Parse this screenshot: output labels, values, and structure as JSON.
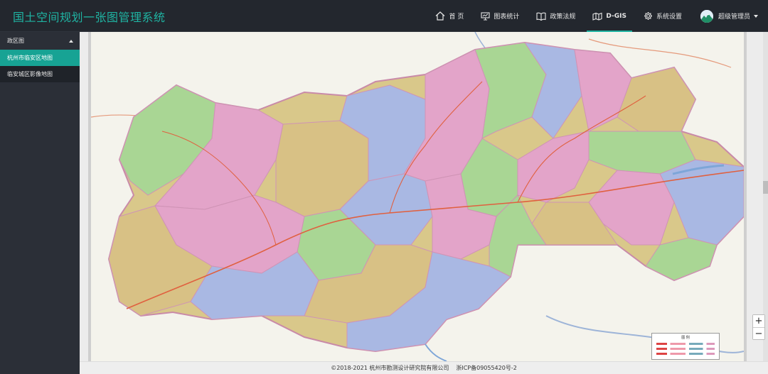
{
  "app": {
    "title": "国土空间规划一张图管理系统"
  },
  "nav": [
    {
      "label": "首 页",
      "icon": "home-icon"
    },
    {
      "label": "图表统计",
      "icon": "chart-icon"
    },
    {
      "label": "政策法规",
      "icon": "book-icon"
    },
    {
      "label": "D-GIS",
      "icon": "map-icon",
      "active": true
    },
    {
      "label": "系统设置",
      "icon": "gear-icon"
    }
  ],
  "user": {
    "name": "超级管理员"
  },
  "sidebar": {
    "group_label": "政区图",
    "items": [
      {
        "label": "杭州市临安区地图",
        "active": true
      },
      {
        "label": "临安城区影像地图"
      }
    ]
  },
  "map": {
    "zoom_in": "+",
    "zoom_out": "−",
    "legend_title": "图 例"
  },
  "footer": {
    "copyright": "©2018-2021 杭州市勘测设计研究院有限公司",
    "icp": "浙ICP备09055420号-2"
  },
  "colors": {
    "accent": "#1fb3a2",
    "topbar": "#23272e",
    "sidebar": "#2b2f37"
  }
}
